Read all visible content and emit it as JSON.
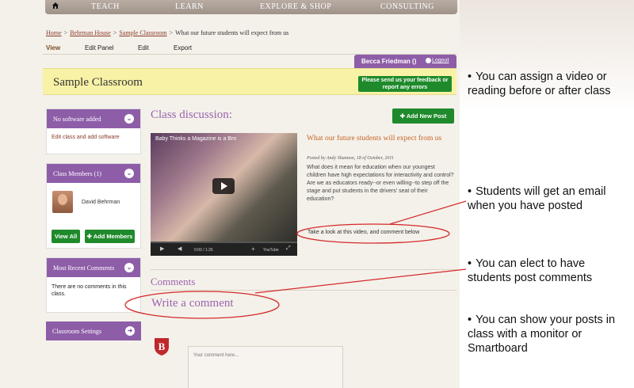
{
  "nav": {
    "items": [
      {
        "label": "TEACH"
      },
      {
        "label": "LEARN"
      },
      {
        "label": "EXPLORE & SHOP"
      },
      {
        "label": "CONSULTING"
      }
    ]
  },
  "breadcrumb": {
    "home": "Home",
    "house": "Behrman House",
    "classroom": "Sample Classroom",
    "current": "What our future students will expect from us",
    "separator": ">"
  },
  "tabs": {
    "view": "View",
    "edit_panel": "Edit Panel",
    "edit": "Edit",
    "export": "Export"
  },
  "user": {
    "name": "Becca Friedman ()",
    "logout": "Logout"
  },
  "classroom": {
    "title": "Sample Classroom",
    "feedback": "Please send us your feedback or report any errors"
  },
  "sidebar": {
    "software": {
      "header": "No software added",
      "link": "Edit class and add software"
    },
    "members": {
      "header": "Class Members (1)",
      "member_name": "David Behrman",
      "view_all": "View All",
      "add_members": "Add Members"
    },
    "recent": {
      "header": "Most Recent Comments",
      "empty": "There are no comments in this class."
    },
    "settings": {
      "header": "Classroom Settings"
    }
  },
  "main": {
    "heading": "Class discussion:",
    "add_post": "Add New Post",
    "video": {
      "title": "Baby Thinks a Magazine is a Bro",
      "time": "0:00 / 1:26",
      "brand": "YouTube"
    },
    "post": {
      "title": "What our future students will expect from us",
      "meta": "Posted by Andy Shannon, 18 of October, 2011",
      "body": "What does it mean for education when our youngest children have high expectations for interactivity and control? Are we as educators ready--or even willing--to step off the stage and put students in the drivers' seat of their education?",
      "note": "Take a look at this video, and comment below"
    },
    "comments_heading": "Comments",
    "write_comment": "Write a comment",
    "comment_placeholder": "Your comment here..."
  },
  "annotations": [
    {
      "text": "You can assign a video or reading before or after class"
    },
    {
      "text": "Students will get an email when you have posted"
    },
    {
      "text": "You can elect to have students post comments"
    },
    {
      "text": "You can show your posts in class with a monitor or Smartboard"
    }
  ],
  "colors": {
    "purple": "#8e5da8",
    "green": "#1f8a2b",
    "orange": "#c46225",
    "annotation_red": "#d42a2a"
  }
}
